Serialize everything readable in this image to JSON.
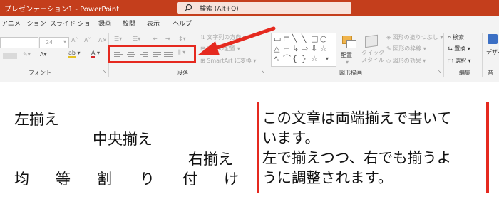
{
  "titlebar": {
    "app_title": "プレゼンテーション1 - PowerPoint",
    "search_placeholder": "検索 (Alt+Q)",
    "color": "#c43e1c"
  },
  "tabs": [
    "アニメーション",
    "スライド ショー",
    "録画",
    "校閲",
    "表示",
    "ヘルプ"
  ],
  "ribbon": {
    "font_group_label": "フォント",
    "font_size": "24",
    "paragraph_group_label": "段落",
    "text_direction": "文字列の方向",
    "align_text": "文字の配置",
    "smartart": "SmartArt に変換",
    "drawing_group_label": "図形描画",
    "arrange": "配置",
    "quick_styles": "クイック\nスタイル",
    "shape_fill": "図形の塗りつぶし",
    "shape_outline": "図形の枠線",
    "shape_effects": "図形の効果",
    "editing_group_label": "編集",
    "find": "検索",
    "replace": "置換",
    "select": "選択",
    "designer_partial": "デザイ",
    "voice_partial": "音"
  },
  "highlight_color": "#e5291f",
  "slide": {
    "left_align": "左揃え",
    "center_align": "中央揃え",
    "right_align": "右揃え",
    "distributed_chars": [
      "均",
      "等",
      "割",
      "り",
      "付",
      "け"
    ],
    "justify_lines": [
      "この文章は両端揃えで書いて",
      "います。",
      "左で揃えつつ、右でも揃うよ",
      "うに調整されます。"
    ]
  }
}
